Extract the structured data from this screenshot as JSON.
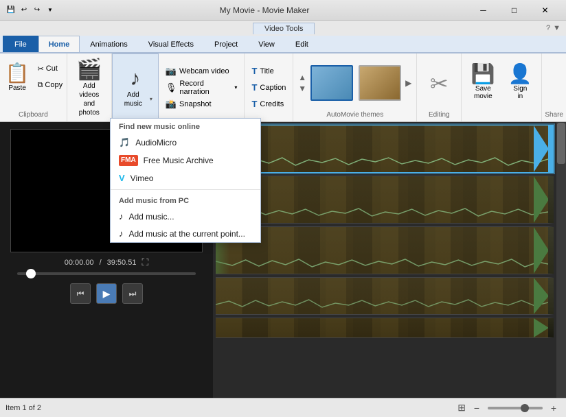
{
  "titlebar": {
    "quick_icons": [
      "💾",
      "↩",
      "↪"
    ],
    "title": "My Movie - Movie Maker",
    "min_btn": "─",
    "max_btn": "□",
    "close_btn": "✕"
  },
  "video_tools_bar": {
    "tab_label": "Video Tools",
    "help_icon": "?",
    "arrow_icon": "▼"
  },
  "ribbon_tabs": [
    {
      "id": "file",
      "label": "File",
      "active": false
    },
    {
      "id": "home",
      "label": "Home",
      "active": true
    },
    {
      "id": "animations",
      "label": "Animations",
      "active": false
    },
    {
      "id": "visual_effects",
      "label": "Visual Effects",
      "active": false
    },
    {
      "id": "project",
      "label": "Project",
      "active": false
    },
    {
      "id": "view",
      "label": "View",
      "active": false
    },
    {
      "id": "edit",
      "label": "Edit",
      "active": false
    }
  ],
  "ribbon": {
    "clipboard_label": "Clipboard",
    "paste_label": "Paste",
    "cut_label": "Cut",
    "copy_label": "Copy",
    "add_videos_label": "Add videos\nand photos",
    "add_music_label": "Add\nmusic",
    "dropdown_arrow": "▾",
    "webcam_label": "Webcam video",
    "record_narration_label": "Record narration",
    "snapshot_label": "Snapshot",
    "title_label": "Title",
    "caption_label": "Caption",
    "credits_label": "Credits",
    "automovie_label": "AutoMovie themes",
    "editing_label": "Editing",
    "save_movie_label": "Save\nmovie",
    "share_label": "Share",
    "sign_in_label": "Sign\nin"
  },
  "dropdown_menu": {
    "section1_label": "Find new music online",
    "item1_label": "AudioMicro",
    "item2_label": "Free Music Archive",
    "item3_label": "Vimeo",
    "section2_label": "Add music from PC",
    "item4_label": "Add music...",
    "item5_label": "Add music at the current point..."
  },
  "player": {
    "time_current": "00:00.00",
    "time_total": "39:50.51"
  },
  "status_bar": {
    "item_label": "Item 1 of 2",
    "zoom_minus": "─",
    "zoom_plus": "+"
  }
}
